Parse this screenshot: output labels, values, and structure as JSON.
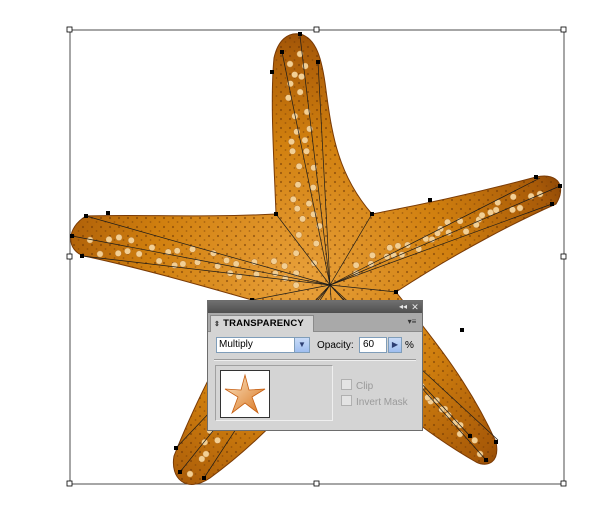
{
  "panel": {
    "title": "TRANSPARENCY",
    "collapse_glyph": "◂◂",
    "close_glyph": "✕",
    "menu_glyph": "▾≡",
    "tab_glyph": "⇕",
    "blend_mode": "Multiply",
    "opacity_label": "Opacity:",
    "opacity_value": "60",
    "opacity_unit": "%",
    "clip_label": "Clip",
    "invert_mask_label": "Invert Mask",
    "clip_checked": false,
    "invert_mask_checked": false
  },
  "artwork": {
    "subject": "starfish",
    "fill_color": "#c8780a",
    "shade_color": "#8a4206",
    "bump_color": "#f2cf94",
    "selection_color": "#000000"
  },
  "icons": [
    "collapse-icon",
    "close-icon",
    "panel-menu-icon",
    "dropdown-arrow-icon",
    "stepper-arrow-icon",
    "tab-arrows-icon",
    "starfish-thumbnail-icon"
  ]
}
